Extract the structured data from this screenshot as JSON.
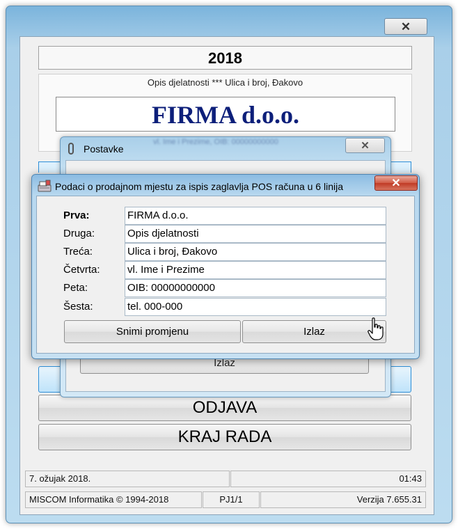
{
  "main": {
    "year": "2018",
    "header_desc": "Opis djelatnosti *** Ulica i broj, Đakovo",
    "company": "FIRMA d.o.o.",
    "header_blur": "vl. Ime i Prezime, OIB: 00000000000",
    "odjava_label": "ODJAVA",
    "kraj_rada_label": "KRAJ RADA",
    "close_glyph": "✕"
  },
  "status": {
    "date": "7. ožujak 2018.",
    "time": "01:43",
    "vendor": "MISCOM Informatika © 1994-2018",
    "terminal": "PJ1/1",
    "version": "Verzija 7.655.31"
  },
  "postavke": {
    "title": "Postavke",
    "close_glyph": "✕",
    "izlaz_label": "Izlaz"
  },
  "podaci": {
    "title": "Podaci o prodajnom mjestu za ispis zaglavlja POS računa u 6 linija",
    "close_glyph": "✕",
    "rows": [
      {
        "label": "Prva:",
        "value": "FIRMA d.o.o."
      },
      {
        "label": "Druga:",
        "value": "Opis djelatnosti"
      },
      {
        "label": "Treća:",
        "value": "Ulica i broj, Đakovo"
      },
      {
        "label": "Četvrta:",
        "value": "vl. Ime i Prezime"
      },
      {
        "label": "Peta:",
        "value": "OIB: 00000000000"
      },
      {
        "label": "Šesta:",
        "value": "tel. 000-000"
      }
    ],
    "save_label": "Snimi promjenu",
    "exit_label": "Izlaz"
  },
  "colors": {
    "company_text": "#0d1f7a",
    "title_bar": "#8cbce2",
    "close_red": "#c03a25"
  }
}
